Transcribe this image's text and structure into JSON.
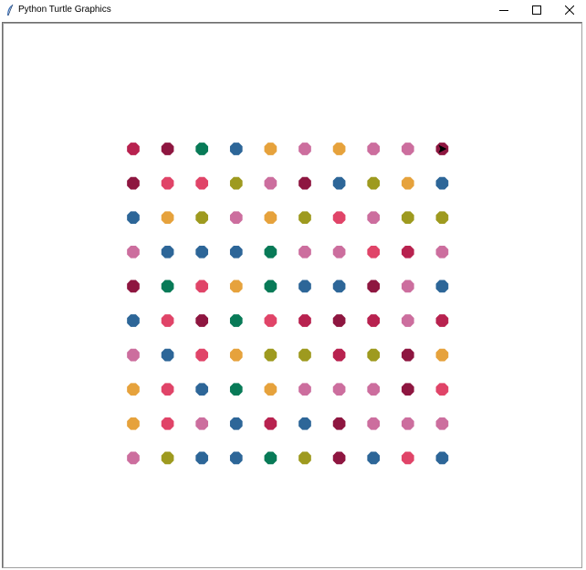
{
  "window": {
    "title": "Python Turtle Graphics",
    "app_icon": "python-feather-icon",
    "controls": {
      "minimize_icon": "minimize-icon",
      "maximize_icon": "maximize-icon",
      "close_icon": "close-icon"
    }
  },
  "canvas": {
    "background": "#ffffff",
    "turtle_icon": "turtle-arrow-icon",
    "turtle_color": "#000000"
  },
  "palette": {
    "crimson": "#b8224f",
    "maroon": "#8e1640",
    "green": "#087a57",
    "blue": "#2d6698",
    "orange": "#e6a23c",
    "pink": "#cc6e9e",
    "rose": "#e04468",
    "olive": "#9e9a1f"
  },
  "dot_grid": {
    "rows": 10,
    "cols": 10,
    "colors": [
      [
        "crimson",
        "maroon",
        "green",
        "blue",
        "orange",
        "pink",
        "orange",
        "pink",
        "pink",
        "maroon"
      ],
      [
        "maroon",
        "rose",
        "rose",
        "olive",
        "pink",
        "maroon",
        "blue",
        "olive",
        "orange",
        "blue"
      ],
      [
        "blue",
        "orange",
        "olive",
        "pink",
        "orange",
        "olive",
        "rose",
        "pink",
        "olive",
        "olive"
      ],
      [
        "pink",
        "blue",
        "blue",
        "blue",
        "green",
        "pink",
        "pink",
        "rose",
        "crimson",
        "pink"
      ],
      [
        "maroon",
        "green",
        "rose",
        "orange",
        "green",
        "blue",
        "blue",
        "maroon",
        "pink",
        "blue"
      ],
      [
        "blue",
        "rose",
        "maroon",
        "green",
        "rose",
        "crimson",
        "maroon",
        "crimson",
        "pink",
        "crimson"
      ],
      [
        "pink",
        "blue",
        "rose",
        "orange",
        "olive",
        "olive",
        "crimson",
        "olive",
        "maroon",
        "orange"
      ],
      [
        "orange",
        "rose",
        "blue",
        "green",
        "orange",
        "pink",
        "pink",
        "pink",
        "maroon",
        "rose"
      ],
      [
        "orange",
        "rose",
        "pink",
        "blue",
        "crimson",
        "blue",
        "maroon",
        "pink",
        "pink",
        "pink"
      ],
      [
        "pink",
        "olive",
        "blue",
        "blue",
        "green",
        "olive",
        "maroon",
        "blue",
        "rose",
        "blue"
      ]
    ]
  }
}
